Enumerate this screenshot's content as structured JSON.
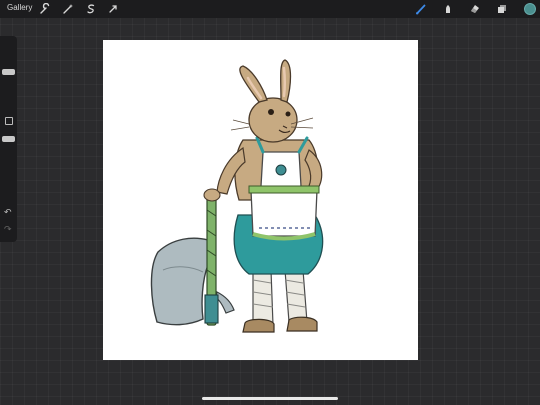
{
  "topbar": {
    "gallery_label": "Gallery",
    "left_tools": [
      "wrench-icon",
      "magic-wand-icon",
      "selection-icon",
      "transform-icon"
    ],
    "right_tools": [
      "brush-icon",
      "smudge-icon",
      "eraser-icon",
      "layers-icon"
    ],
    "active_tool": "brush-icon",
    "active_color": "#4a8f8f"
  },
  "sidebar": {
    "tools": [
      "brush-size-slider",
      "modify-button",
      "opacity-slider",
      "undo-icon",
      "redo-icon"
    ]
  },
  "canvas": {
    "artwork": "rabbit-adventurer-with-axe"
  }
}
